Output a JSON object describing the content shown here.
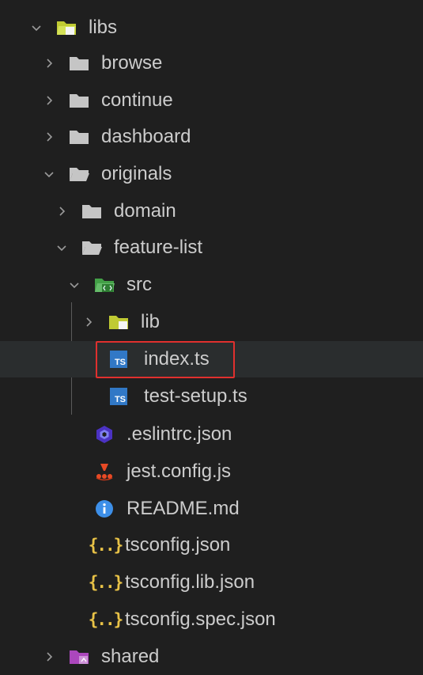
{
  "tree": {
    "items": [
      {
        "label": "libs",
        "icon": "folder-open-special-icon",
        "expanded": true
      },
      {
        "label": "browse",
        "icon": "folder-icon",
        "expanded": false
      },
      {
        "label": "continue",
        "icon": "folder-icon",
        "expanded": false
      },
      {
        "label": "dashboard",
        "icon": "folder-icon",
        "expanded": false
      },
      {
        "label": "originals",
        "icon": "folder-open-icon",
        "expanded": true
      },
      {
        "label": "domain",
        "icon": "folder-icon",
        "expanded": false
      },
      {
        "label": "feature-list",
        "icon": "folder-open-icon",
        "expanded": true
      },
      {
        "label": "src",
        "icon": "folder-src-open-icon",
        "expanded": true
      },
      {
        "label": "lib",
        "icon": "folder-lib-icon",
        "expanded": false
      },
      {
        "label": "index.ts",
        "icon": "typescript-icon",
        "selected": true
      },
      {
        "label": "test-setup.ts",
        "icon": "typescript-icon"
      },
      {
        "label": ".eslintrc.json",
        "icon": "eslint-icon"
      },
      {
        "label": "jest.config.js",
        "icon": "jest-icon"
      },
      {
        "label": "README.md",
        "icon": "info-icon"
      },
      {
        "label": "tsconfig.json",
        "icon": "json-icon"
      },
      {
        "label": "tsconfig.lib.json",
        "icon": "json-icon"
      },
      {
        "label": "tsconfig.spec.json",
        "icon": "json-icon"
      },
      {
        "label": "shared",
        "icon": "folder-shared-icon",
        "expanded": false
      }
    ]
  },
  "icons": {
    "ts_text": "TS",
    "json_text": "{..}"
  },
  "colors": {
    "background": "#1f1f1f",
    "selected_row": "#2a2d2e",
    "highlight_border": "#e0302e",
    "typescript": "#3178c6",
    "folder": "#c5c5c5",
    "json": "#e8c247"
  }
}
